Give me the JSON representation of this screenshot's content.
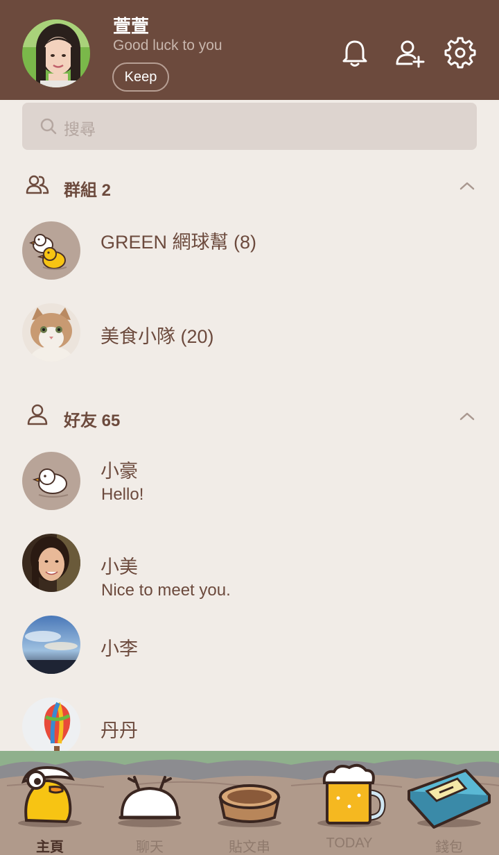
{
  "header": {
    "name": "萱萱",
    "status": "Good luck to you",
    "keep_label": "Keep"
  },
  "search": {
    "placeholder": "搜尋"
  },
  "groups": {
    "title": "群組 2",
    "items": [
      {
        "name": "GREEN 網球幫 (8)"
      },
      {
        "name": "美食小隊 (20)"
      }
    ]
  },
  "friends": {
    "title": "好友 65",
    "items": [
      {
        "name": "小豪",
        "message": "Hello!"
      },
      {
        "name": "小美",
        "message": "Nice to meet you."
      },
      {
        "name": "小李",
        "message": ""
      },
      {
        "name": "丹丹",
        "message": ""
      }
    ]
  },
  "tabs": [
    {
      "label": "主頁",
      "active": true
    },
    {
      "label": "聊天",
      "active": false
    },
    {
      "label": "貼文串",
      "active": false
    },
    {
      "label": "TODAY",
      "active": false
    },
    {
      "label": "錢包",
      "active": false
    }
  ],
  "colors": {
    "header_bg": "#6c4a3d",
    "page_bg": "#f1ece7",
    "text_brown": "#6c4a3d"
  }
}
